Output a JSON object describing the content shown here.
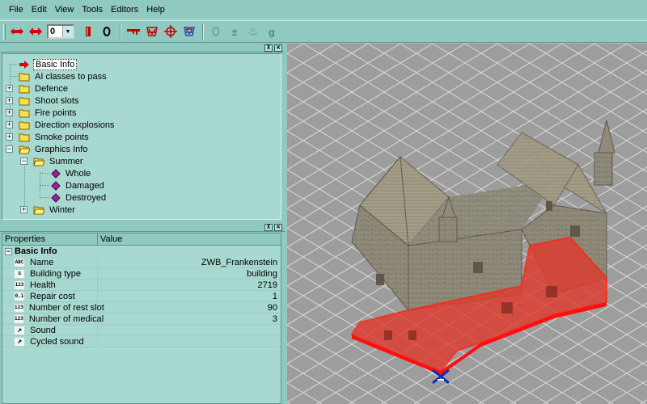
{
  "menu": {
    "items": [
      {
        "label": "File"
      },
      {
        "label": "Edit"
      },
      {
        "label": "View"
      },
      {
        "label": "Tools"
      },
      {
        "label": "Editors"
      },
      {
        "label": "Help"
      }
    ]
  },
  "toolbar": {
    "combo_value": "0",
    "buttons": [
      "move-arrows",
      "move-diamond",
      "red-marker",
      "select-circle",
      "key",
      "defence-red",
      "target",
      "defence-blue",
      "disabled-circle",
      "disabled-stack",
      "disabled-fire",
      "disabled-g"
    ],
    "disabled_labels": {
      "circle": "0",
      "stack": "±",
      "fire": "♨",
      "g": "g"
    },
    "colors": {
      "accent": "#d40000",
      "bg": "#8fc9bf"
    }
  },
  "tree": {
    "items": [
      {
        "label": "Basic Info",
        "selected": true
      },
      {
        "label": "AI classes to pass"
      },
      {
        "label": "Defence"
      },
      {
        "label": "Shoot slots"
      },
      {
        "label": "Fire points"
      },
      {
        "label": "Direction explosions"
      },
      {
        "label": "Smoke points"
      },
      {
        "label": "Graphics Info"
      },
      {
        "label": "Summer"
      },
      {
        "label": "Whole"
      },
      {
        "label": "Damaged"
      },
      {
        "label": "Destroyed"
      },
      {
        "label": "Winter"
      }
    ]
  },
  "properties": {
    "columns": {
      "name": "Properties",
      "value": "Value"
    },
    "group": "Basic Info",
    "rows": [
      {
        "icon": "ABC",
        "name": "Name",
        "value": "ZWB_Frankenstein"
      },
      {
        "icon": "list",
        "name": "Building type",
        "value": "building"
      },
      {
        "icon": "123",
        "name": "Health",
        "value": "2719"
      },
      {
        "icon": "0.1",
        "name": "Repair cost",
        "value": "1"
      },
      {
        "icon": "123",
        "name": "Number of rest slot",
        "value": "90"
      },
      {
        "icon": "123",
        "name": "Number of medical",
        "value": "3"
      },
      {
        "icon": "arrow",
        "name": "Sound",
        "value": ""
      },
      {
        "icon": "arrow",
        "name": "Cycled sound",
        "value": ""
      }
    ]
  },
  "caption_buttons": {
    "pin": "⊼",
    "close": "✕"
  }
}
